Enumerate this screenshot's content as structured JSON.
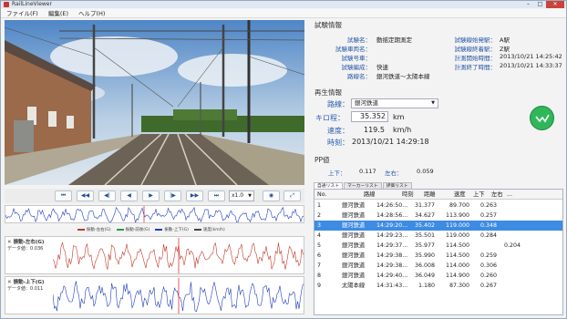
{
  "window": {
    "title": "RailLineViewer"
  },
  "menu": [
    "ファイル(F)",
    "編集(E)",
    "ヘルプ(H)"
  ],
  "controls": {
    "speed": "x1.0"
  },
  "overview_legend": [
    "振動-左右(G)",
    "振動-前後(G)",
    "振動-上下(G)",
    "速度(km/h)"
  ],
  "chart1": {
    "title": "振動-左右(G)",
    "label": "データ値：",
    "value": "0.036"
  },
  "chart2": {
    "title": "振動-上下(G)",
    "label": "データ値：",
    "value": "0.011"
  },
  "test_info": {
    "section_title": "試験情報",
    "left": [
      {
        "k": "試験名：",
        "v": "動揺定期測定"
      },
      {
        "k": "試験車両名：",
        "v": ""
      },
      {
        "k": "試験号車：",
        "v": ""
      },
      {
        "k": "試験編成：",
        "v": "快速"
      },
      {
        "k": "路線名：",
        "v": "銀河鉄道～太陽本線"
      }
    ],
    "right": [
      {
        "k": "試験線始発駅：",
        "v": "A駅"
      },
      {
        "k": "試験線終着駅：",
        "v": "Z駅"
      },
      {
        "k": "計測開始時間：",
        "v": "2013/10/21 14:25:42"
      },
      {
        "k": "計測終了時間：",
        "v": "2013/10/21 14:33:37"
      }
    ]
  },
  "playback": {
    "section_title": "再生情報",
    "route_label": "路線：",
    "route_value": "銀河鉄道",
    "km_label": "キロ程：",
    "km_value": "35.352",
    "km_unit": "km",
    "speed_label": "速度：",
    "speed_value": "119.5",
    "speed_unit": "km/h",
    "time_label": "時刻：",
    "time_value": "2013/10/21 14:29:18"
  },
  "pp": {
    "section_title": "PP値",
    "ud_label": "上下：",
    "ud_value": "0.117",
    "lr_label": "左右：",
    "lr_value": "0.059"
  },
  "tabs": [
    "自通リスト",
    "マーカーリスト",
    "評価リスト"
  ],
  "list": {
    "headers": [
      "No.",
      "路線",
      "時刻",
      "距離",
      "速度",
      "上下",
      "左右",
      "..."
    ],
    "selected": 2,
    "rows": [
      [
        "1",
        "銀河鉄道",
        "14:26:50...",
        "31.377",
        "89.700",
        "0.263",
        ""
      ],
      [
        "2",
        "銀河鉄道",
        "14:28:56...",
        "34.627",
        "113.900",
        "0.257",
        ""
      ],
      [
        "3",
        "銀河鉄道",
        "14:29:20...",
        "35.402",
        "119.000",
        "0.348",
        ""
      ],
      [
        "4",
        "銀河鉄道",
        "14:29:23...",
        "35.501",
        "119.000",
        "0.284",
        ""
      ],
      [
        "5",
        "銀河鉄道",
        "14:29:37...",
        "35.977",
        "114.500",
        "",
        "0.204"
      ],
      [
        "6",
        "銀河鉄道",
        "14:29:38...",
        "35.990",
        "114.500",
        "0.259",
        ""
      ],
      [
        "7",
        "銀河鉄道",
        "14:29:38...",
        "36.008",
        "114.000",
        "0.306",
        ""
      ],
      [
        "8",
        "銀河鉄道",
        "14:29:40...",
        "36.049",
        "114.900",
        "0.260",
        ""
      ],
      [
        "9",
        "太陽本線",
        "14:31:43...",
        "1.180",
        "87.300",
        "0.267",
        ""
      ]
    ]
  }
}
